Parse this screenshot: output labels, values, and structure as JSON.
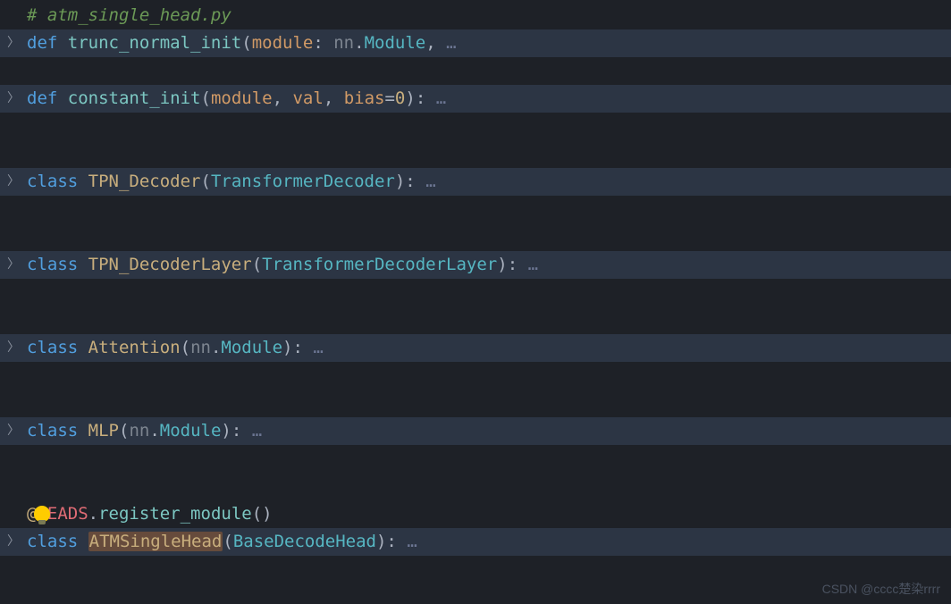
{
  "comment": "# atm_single_head.py",
  "lines": [
    {
      "keyword": "def",
      "name": "trunc_normal_init",
      "params_html": "<span class='param'>module</span><span class='punct'>: </span><span class='param-dim'>nn</span><span class='punct'>.</span><span class='type-name'>Module</span><span class='punct'>,</span>",
      "close": "",
      "ellipsis": "…"
    },
    {
      "keyword": "def",
      "name": "constant_init",
      "params_html": "<span class='param'>module</span><span class='punct'>, </span><span class='param'>val</span><span class='punct'>, </span><span class='param'>bias</span><span class='punct'>=</span><span class='num'>0</span>",
      "close": "):",
      "ellipsis": "…"
    },
    {
      "keyword": "class",
      "name": "TPN_Decoder",
      "params_html": "<span class='type-name'>TransformerDecoder</span>",
      "close": "):",
      "ellipsis": "…"
    },
    {
      "keyword": "class",
      "name": "TPN_DecoderLayer",
      "params_html": "<span class='type-name'>TransformerDecoderLayer</span>",
      "close": "):",
      "ellipsis": "…"
    },
    {
      "keyword": "class",
      "name": "Attention",
      "params_html": "<span class='param-dim'>nn</span><span class='punct'>.</span><span class='type-name'>Module</span>",
      "close": "):",
      "ellipsis": "…"
    },
    {
      "keyword": "class",
      "name": "MLP",
      "params_html": "<span class='param-dim'>nn</span><span class='punct'>.</span><span class='type-name'>Module</span>",
      "close": "):",
      "ellipsis": "…"
    }
  ],
  "decorator": {
    "at": "@",
    "head": "HEADS",
    "dot": ".",
    "fn": "register_module",
    "paren": "()"
  },
  "last": {
    "keyword": "class",
    "name": "ATMSingleHead",
    "base": "BaseDecodeHead",
    "close": "):",
    "ellipsis": "…"
  },
  "watermark": "CSDN @cccc楚染rrrr"
}
